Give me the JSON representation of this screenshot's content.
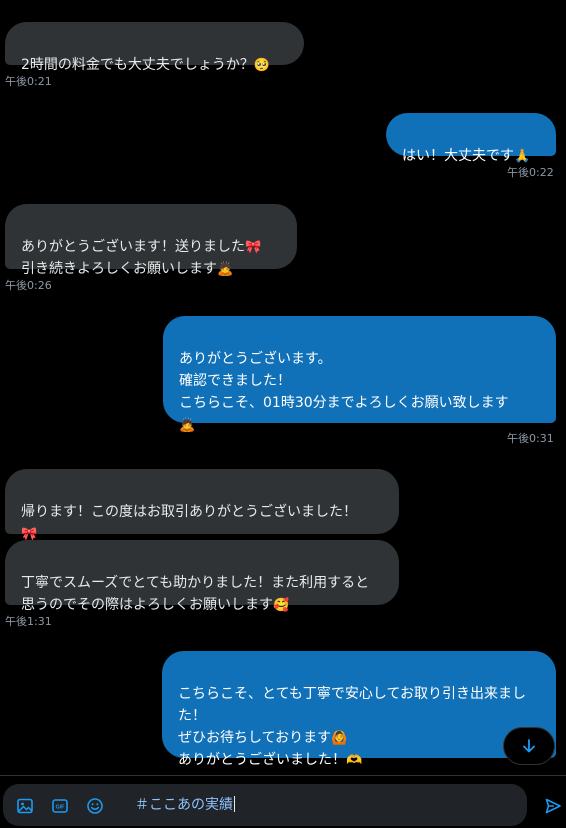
{
  "messages": [
    {
      "text": "2時間の料金でも大丈夫でしょうか？",
      "emoji": "🥺",
      "time": "午後0:21"
    },
    {
      "text": "はい！大丈夫です",
      "emoji": "🙏",
      "time": "午後0:22"
    },
    {
      "text1": "ありがとうございます！送りました",
      "emoji1": "🎀",
      "text2": "引き続きよろしくお願いします",
      "emoji2": "🙇",
      "time": "午後0:26"
    },
    {
      "text": "ありがとうございます。\n確認できました！\nこちらこそ、01時30分までよろしくお願い致します",
      "emoji": "🙇",
      "time": "午後0:31"
    },
    {
      "text": "帰ります！この度はお取引ありがとうございました！",
      "emoji": "🎀"
    },
    {
      "text": "丁寧でスムーズでとても助かりました！また利用すると思うのでその際はよろしくお願いします",
      "emoji": "🥰",
      "time": "午後1:31"
    },
    {
      "text1": "こちらこそ、とても丁寧で安心してお取り引き出来ました！\nぜひお待ちしております",
      "emoji1": "🙆",
      "text2": "ありがとうございました！",
      "emoji2": "🫶"
    }
  ],
  "composer": {
    "text": "＃ここあの実績",
    "icons": [
      "image-icon",
      "gif-icon",
      "emoji-icon",
      "send-icon"
    ]
  },
  "colors": {
    "incoming": "#2f3336",
    "outgoing": "#1071b8",
    "accent": "#1d9bf0"
  }
}
